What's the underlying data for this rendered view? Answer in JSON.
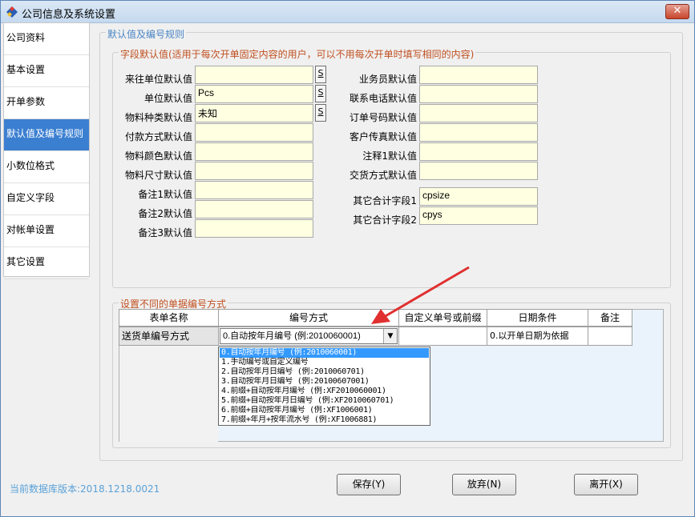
{
  "window": {
    "title": "公司信息及系统设置",
    "close": "✕"
  },
  "sidebar": {
    "items": [
      {
        "label": "公司资料"
      },
      {
        "label": "基本设置"
      },
      {
        "label": "开单参数"
      },
      {
        "label": "默认值及编号规则",
        "active": true
      },
      {
        "label": "小数位格式"
      },
      {
        "label": "自定义字段"
      },
      {
        "label": "对帐单设置"
      },
      {
        "label": "其它设置"
      }
    ]
  },
  "main": {
    "section_title": "默认值及编号规则",
    "defaults": {
      "legend": "字段默认值(适用于每次开单固定内容的用户，可以不用每次开单时填写相同的内容)",
      "left_fields": [
        {
          "label": "来往单位默认值",
          "value": "",
          "s_button": "S"
        },
        {
          "label": "单位默认值",
          "value": "Pcs",
          "s_button": "S"
        },
        {
          "label": "物料种类默认值",
          "value": "未知",
          "s_button": "S"
        },
        {
          "label": "付款方式默认值",
          "value": ""
        },
        {
          "label": "物料颜色默认值",
          "value": ""
        },
        {
          "label": "物料尺寸默认值",
          "value": ""
        },
        {
          "label": "备注1默认值",
          "value": ""
        },
        {
          "label": "备注2默认值",
          "value": ""
        },
        {
          "label": "备注3默认值",
          "value": ""
        }
      ],
      "right_fields": [
        {
          "label": "业务员默认值",
          "value": ""
        },
        {
          "label": "联系电话默认值",
          "value": ""
        },
        {
          "label": "订单号码默认值",
          "value": ""
        },
        {
          "label": "客户传真默认值",
          "value": ""
        },
        {
          "label": "注释1默认值",
          "value": ""
        },
        {
          "label": "交货方式默认值",
          "value": ""
        },
        {
          "label": "其它合计字段1",
          "value": "cpsize"
        },
        {
          "label": "其它合计字段2",
          "value": "cpys"
        }
      ]
    },
    "numbering": {
      "legend": "设置不同的单据编号方式",
      "columns": [
        "表单名称",
        "编号方式",
        "自定义单号或前缀",
        "日期条件",
        "备注"
      ],
      "row": {
        "form_name": "送货单编号方式",
        "method": "0.自动按年月编号 (例:2010060001)",
        "prefix": "",
        "date_condition": "0.以开单日期为依据",
        "note": ""
      },
      "dropdown_options": [
        "0.自动按年月编号 (例:2010060001)",
        "1.手动编号或自定义编号",
        "2.自动按年月日编号 (例:2010060701)",
        "3.自动按年月日编号 (例:20100607001)",
        "4.前缀+自动按年月编号 (例:XF2010060001)",
        "5.前缀+自动按年月日编号 (例:XF2010060701)",
        "6.前缀+自动按年月编号 (例:XF1006001)",
        "7.前缀+年月+按年流水号 (例:XF1006881)"
      ],
      "selected_index": 0
    }
  },
  "footer": {
    "version": "当前数据库版本:2018.1218.0021",
    "save": "保存(Y)",
    "discard": "放弃(N)",
    "leave": "离开(X)"
  },
  "colors": {
    "accent": "#3b7fd1",
    "field_bg": "#ffffe1",
    "legend_orange": "#c05020",
    "legend_blue": "#4a86c5",
    "arrow": "#e03030"
  }
}
